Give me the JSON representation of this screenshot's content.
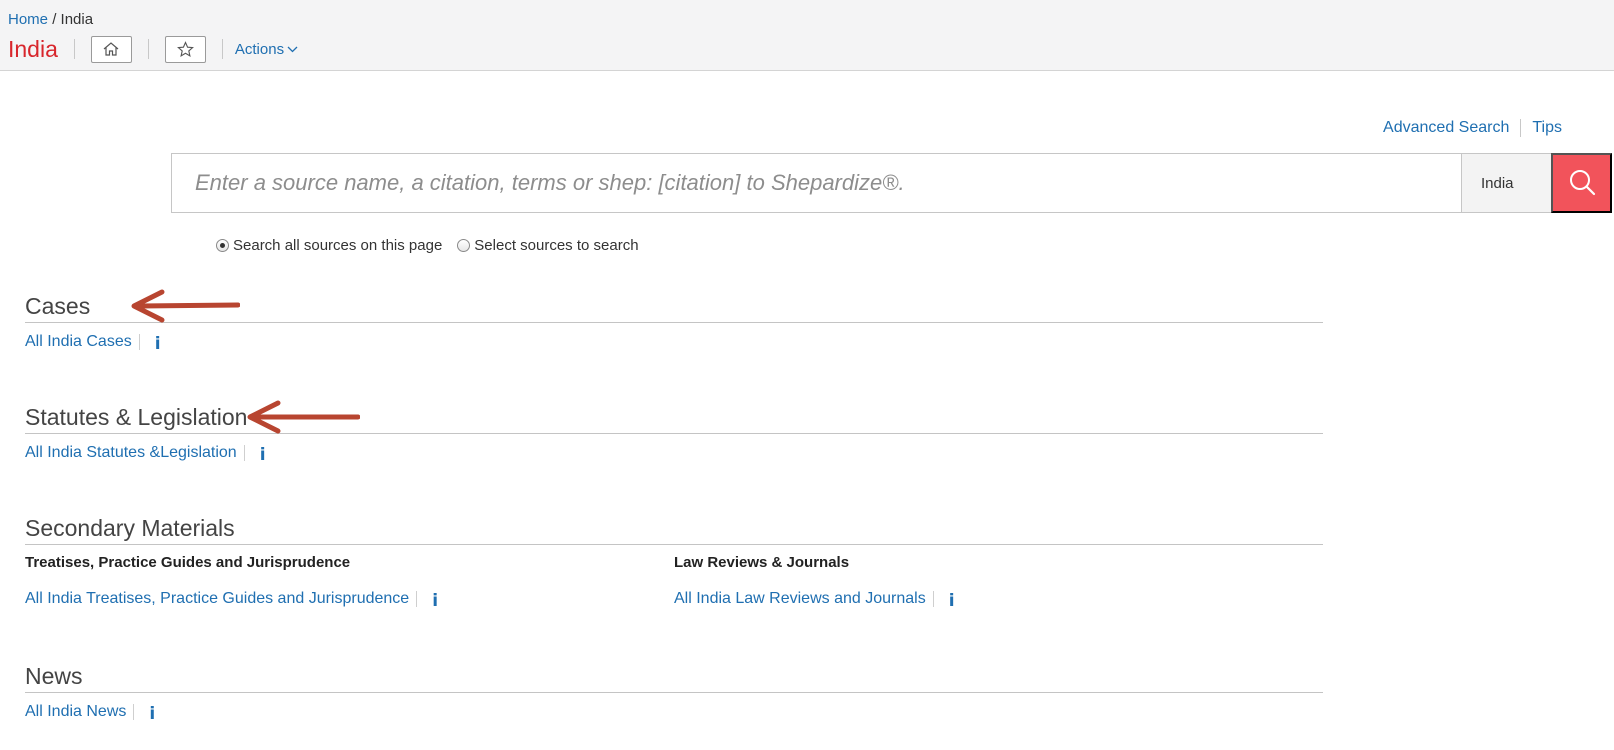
{
  "breadcrumb": {
    "home": "Home",
    "separator": "/",
    "current": "India"
  },
  "header": {
    "title": "India",
    "actions_label": "Actions"
  },
  "icons": {
    "home": "home-icon",
    "favorite": "star-icon",
    "actions": "chevron-down-icon",
    "search": "search-icon",
    "info": "info-icon"
  },
  "top_links": {
    "advanced_search": "Advanced Search",
    "tips": "Tips"
  },
  "search": {
    "placeholder": "Enter a source name, a citation, terms or shep: [citation] to Shepardize®.",
    "value": "",
    "scope": "India"
  },
  "search_options": {
    "all_sources": "Search all sources on this page",
    "select_sources": "Select sources to search",
    "selected": "all_sources"
  },
  "sections": {
    "cases": {
      "heading": "Cases",
      "link": "All India Cases",
      "info": "i"
    },
    "statutes": {
      "heading": "Statutes & Legislation",
      "link": "All India Statutes &Legislation",
      "info": "i"
    },
    "secondary": {
      "heading": "Secondary Materials",
      "treatises": {
        "subheading": "Treatises, Practice Guides and Jurisprudence",
        "link": "All India Treatises, Practice Guides and Jurisprudence",
        "info": "i"
      },
      "law_reviews": {
        "subheading": "Law Reviews & Journals",
        "link": "All India Law Reviews and Journals",
        "info": "i"
      }
    },
    "news": {
      "heading": "News",
      "link": "All India News",
      "info": "i"
    }
  },
  "colors": {
    "link": "#1f6fb1",
    "title": "#d8262c",
    "search_button": "#f2535b",
    "annotation_arrow": "#b84530"
  }
}
